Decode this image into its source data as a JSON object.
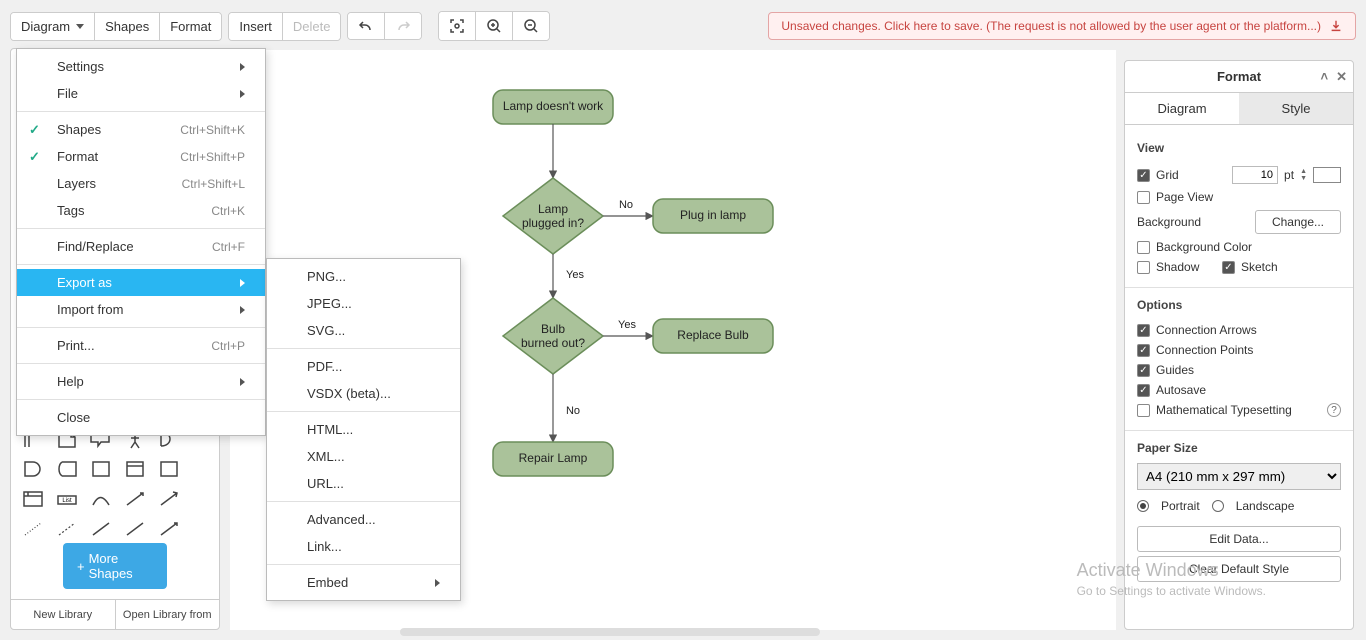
{
  "menubar": {
    "diagram": "Diagram",
    "shapes": "Shapes",
    "format": "Format",
    "insert": "Insert",
    "delete": "Delete"
  },
  "banner": {
    "text": "Unsaved changes. Click here to save. (The request is not allowed by the user agent or the platform...)"
  },
  "diagram_menu": {
    "settings": "Settings",
    "file": "File",
    "shapes": {
      "label": "Shapes",
      "shortcut": "Ctrl+Shift+K",
      "checked": true
    },
    "format": {
      "label": "Format",
      "shortcut": "Ctrl+Shift+P",
      "checked": true
    },
    "layers": {
      "label": "Layers",
      "shortcut": "Ctrl+Shift+L"
    },
    "tags": {
      "label": "Tags",
      "shortcut": "Ctrl+K"
    },
    "find": {
      "label": "Find/Replace",
      "shortcut": "Ctrl+F"
    },
    "export": "Export as",
    "import": "Import from",
    "print": {
      "label": "Print...",
      "shortcut": "Ctrl+P"
    },
    "help": "Help",
    "close": "Close"
  },
  "export_menu": {
    "png": "PNG...",
    "jpeg": "JPEG...",
    "svg": "SVG...",
    "pdf": "PDF...",
    "vsdx": "VSDX (beta)...",
    "html": "HTML...",
    "xml": "XML...",
    "url": "URL...",
    "advanced": "Advanced...",
    "link": "Link...",
    "embed": "Embed"
  },
  "flow": {
    "start": "Lamp doesn't work",
    "d1_l1": "Lamp",
    "d1_l2": "plugged in?",
    "a1": "Plug in lamp",
    "d2_l1": "Bulb",
    "d2_l2": "burned out?",
    "a2": "Replace Bulb",
    "end": "Repair Lamp",
    "yes": "Yes",
    "no": "No"
  },
  "format_panel": {
    "title": "Format",
    "tab_diagram": "Diagram",
    "tab_style": "Style",
    "view": "View",
    "grid": "Grid",
    "grid_val": "10",
    "grid_unit": "pt",
    "pageview": "Page View",
    "background": "Background",
    "change": "Change...",
    "bgcolor": "Background Color",
    "shadow": "Shadow",
    "sketch": "Sketch",
    "options": "Options",
    "conn_arrows": "Connection Arrows",
    "conn_points": "Connection Points",
    "guides": "Guides",
    "autosave": "Autosave",
    "math": "Mathematical Typesetting",
    "paper": "Paper Size",
    "paper_val": "A4 (210 mm x 297 mm)",
    "portrait": "Portrait",
    "landscape": "Landscape",
    "editdata": "Edit Data...",
    "cleardef": "Clear Default Style"
  },
  "sidebar": {
    "more": "More Shapes",
    "newlib": "New Library",
    "openlib": "Open Library from"
  },
  "watermark": {
    "title": "Activate Windows",
    "sub": "Go to Settings to activate Windows."
  },
  "chart_data": {
    "type": "flowchart",
    "nodes": [
      {
        "id": "n1",
        "type": "terminator",
        "label": "Lamp doesn't work"
      },
      {
        "id": "d1",
        "type": "decision",
        "label": "Lamp plugged in?"
      },
      {
        "id": "a1",
        "type": "process",
        "label": "Plug in lamp"
      },
      {
        "id": "d2",
        "type": "decision",
        "label": "Bulb burned out?"
      },
      {
        "id": "a2",
        "type": "process",
        "label": "Replace Bulb"
      },
      {
        "id": "n2",
        "type": "terminator",
        "label": "Repair Lamp"
      }
    ],
    "edges": [
      {
        "from": "n1",
        "to": "d1",
        "label": ""
      },
      {
        "from": "d1",
        "to": "a1",
        "label": "No"
      },
      {
        "from": "d1",
        "to": "d2",
        "label": "Yes"
      },
      {
        "from": "d2",
        "to": "a2",
        "label": "Yes"
      },
      {
        "from": "d2",
        "to": "n2",
        "label": "No"
      }
    ]
  }
}
